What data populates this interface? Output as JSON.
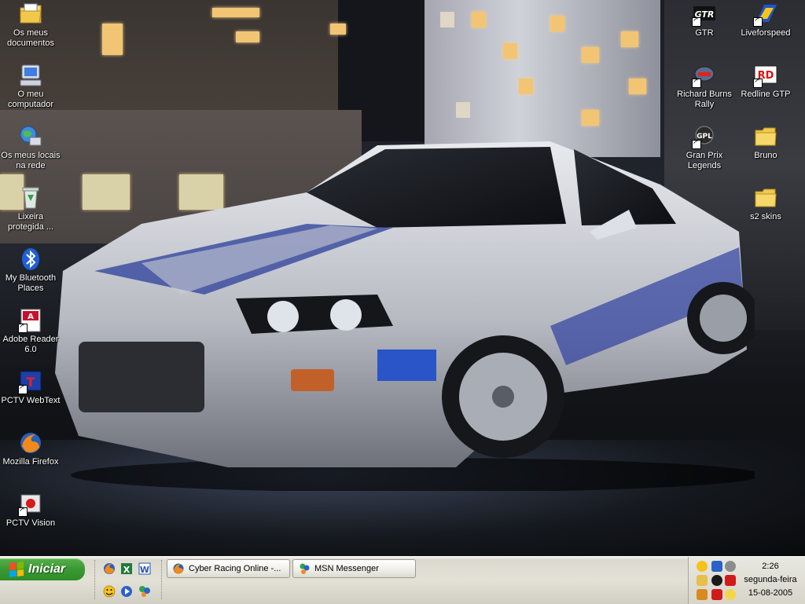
{
  "desktop": {
    "left_icons": [
      {
        "label": "Os meus documentos",
        "icon": "my-documents-icon"
      },
      {
        "label": "O meu computador",
        "icon": "my-computer-icon"
      },
      {
        "label": "Os meus locais na rede",
        "icon": "network-places-icon"
      },
      {
        "label": "Lixeira protegida ...",
        "icon": "recycle-bin-icon"
      },
      {
        "label": "My Bluetooth Places",
        "icon": "bluetooth-icon"
      },
      {
        "label": "Adobe Reader 6.0",
        "icon": "adobe-reader-icon"
      },
      {
        "label": "PCTV WebText",
        "icon": "pctv-webtext-icon"
      },
      {
        "label": "Mozilla Firefox",
        "icon": "firefox-icon"
      },
      {
        "label": "PCTV Vision",
        "icon": "pctv-vision-icon"
      }
    ],
    "right_icons": [
      {
        "label": "GTR",
        "icon": "gtr-icon"
      },
      {
        "label": "Liveforspeed",
        "icon": "liveforspeed-icon"
      },
      {
        "label": "Richard Burns Rally",
        "icon": "richard-burns-rally-icon"
      },
      {
        "label": "Redline GTP",
        "icon": "redline-gtp-icon"
      },
      {
        "label": "Gran Prix Legends",
        "icon": "gran-prix-legends-icon"
      },
      {
        "label": "Bruno",
        "icon": "folder-icon"
      },
      {
        "label": "s2 skins",
        "icon": "folder-icon"
      }
    ]
  },
  "taskbar": {
    "start_label": "Iniciar",
    "quick_launch": [
      "firefox-icon",
      "excel-icon",
      "word-icon",
      "messenger-icon",
      "media-player-icon",
      "msn-icon"
    ],
    "tasks": [
      {
        "label": "Cyber Racing Online -...",
        "icon": "firefox-icon"
      },
      {
        "label": "MSN Messenger",
        "icon": "msn-messenger-icon"
      }
    ],
    "tray_icons": [
      "smiley-icon",
      "msn-tray-icon",
      "disc-icon",
      "network-icon",
      "nvidia-icon",
      "ati-icon",
      "antivirus-icon",
      "messenger-tray-icon"
    ],
    "clock": {
      "time": "2:26",
      "day": "segunda-feira",
      "date": "15-08-2005"
    }
  },
  "colors": {
    "start_green": "#3c9a34",
    "taskbar": "#e3e1d6",
    "label_text": "#ffffff"
  }
}
